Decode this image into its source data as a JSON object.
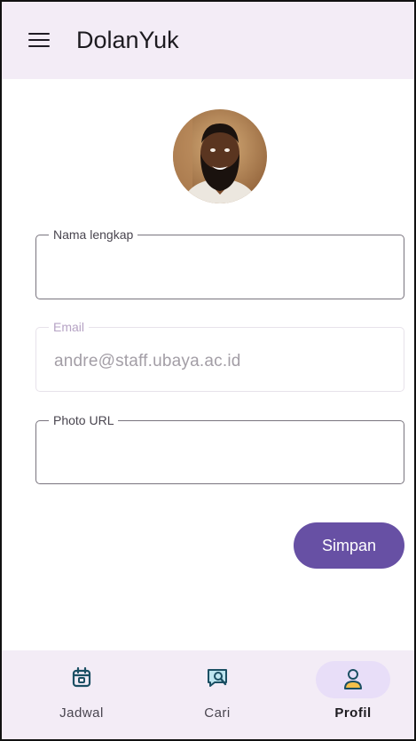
{
  "app": {
    "title": "DolanYuk"
  },
  "form": {
    "name_label": "Nama lengkap",
    "name_value": "",
    "email_label": "Email",
    "email_value": "andre@staff.ubaya.ac.id",
    "photo_label": "Photo URL",
    "photo_value": "",
    "save_label": "Simpan"
  },
  "nav": {
    "items": [
      {
        "label": "Jadwal",
        "icon": "calendar-icon",
        "active": false
      },
      {
        "label": "Cari",
        "icon": "search-chat-icon",
        "active": false
      },
      {
        "label": "Profil",
        "icon": "profile-icon",
        "active": true
      }
    ]
  },
  "colors": {
    "accent": "#6750a4",
    "surface": "#f3ecf6",
    "active_indicator": "#e8def8",
    "icon_tint": "#1b4f63"
  }
}
